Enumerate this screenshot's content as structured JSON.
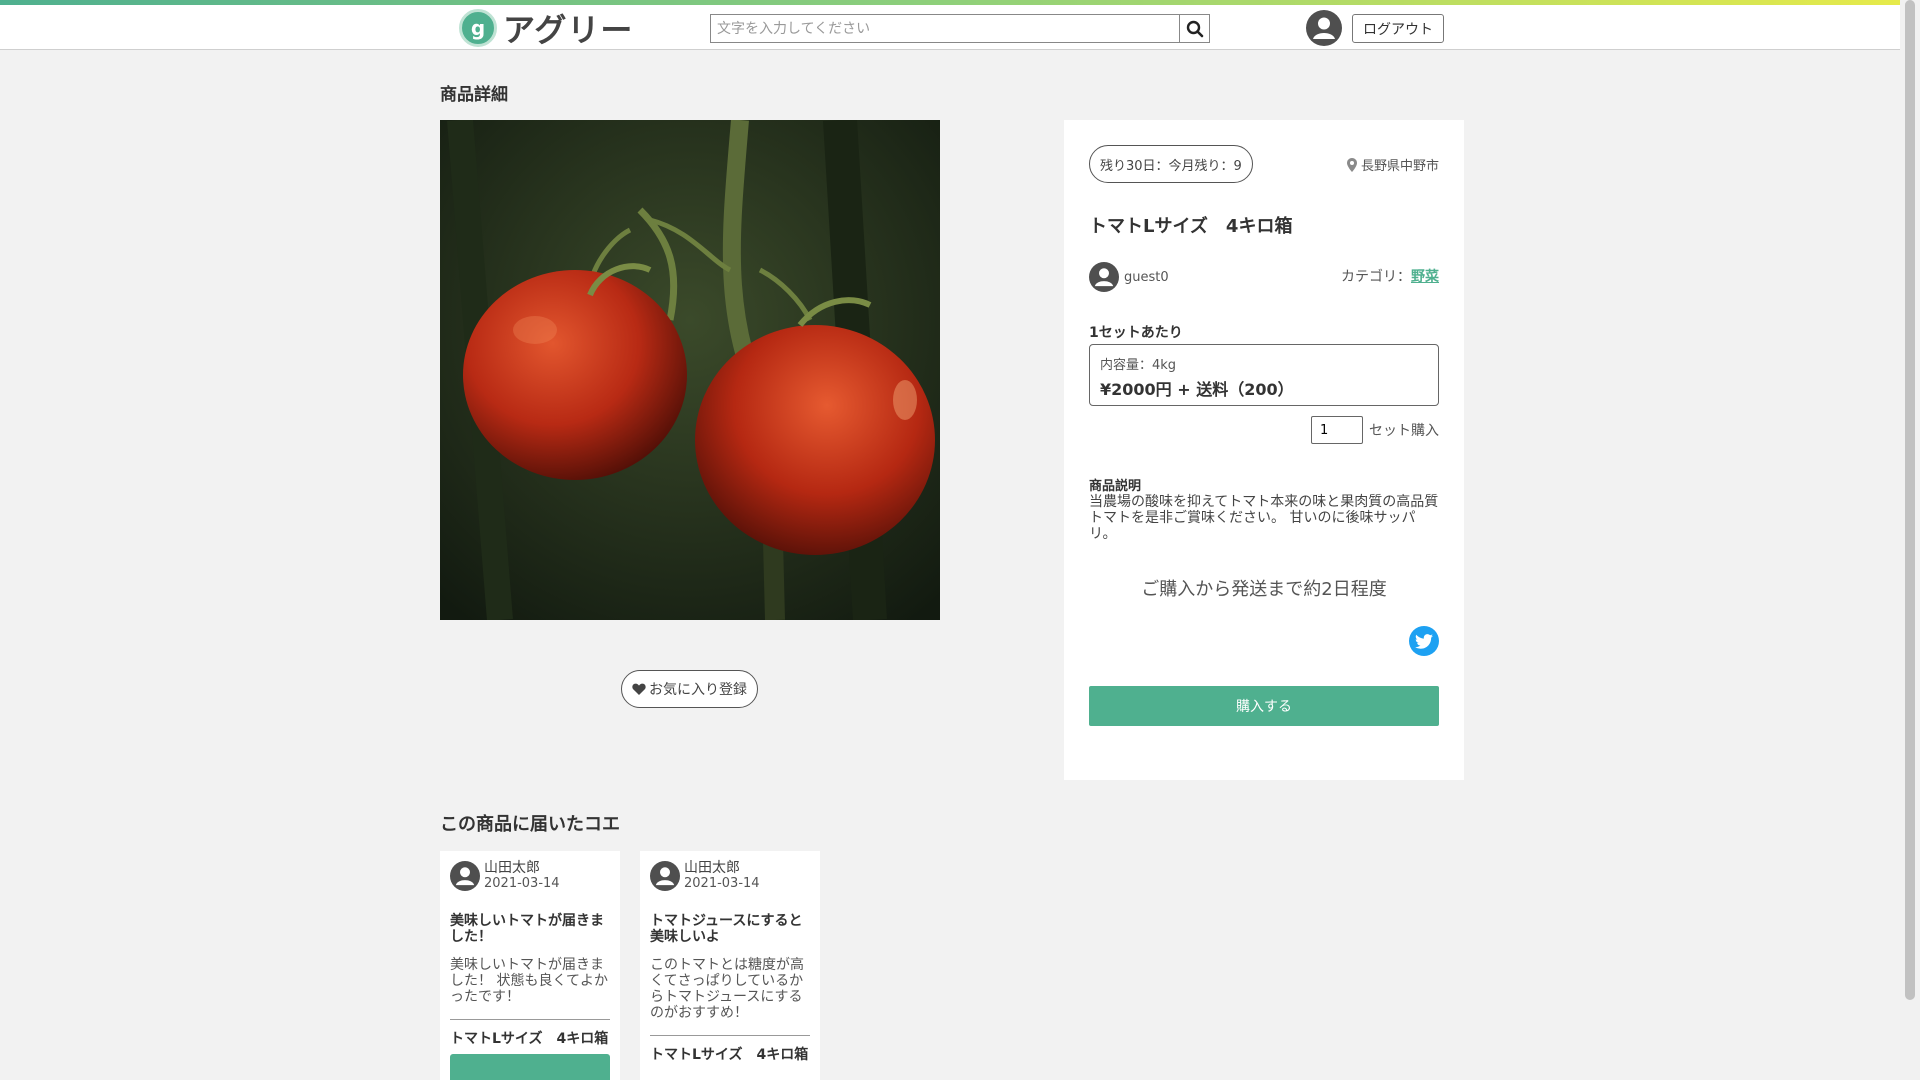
{
  "header": {
    "logo_text": "アグリー",
    "logo_mark": "g",
    "search_placeholder": "文字を入力してください",
    "logout_label": "ログアウト",
    "icons": [
      "search-icon",
      "user-avatar-icon"
    ]
  },
  "page": {
    "title": "商品詳細"
  },
  "favorite": {
    "label": "お気に入り登録",
    "icon": "heart-icon"
  },
  "product": {
    "remaining_badge": "残り30日：今月残り：9",
    "location": "長野県中野市",
    "title": "トマトLサイズ　4キロ箱",
    "seller": "guest0",
    "category_label": "カテゴリ：",
    "category_value": "野菜",
    "per_set_label": "1セットあたり",
    "content_qty": "内容量：4kg",
    "price": "¥2000円 + 送料（200）",
    "quantity": "1",
    "set_purchase_label": "セット購入",
    "description_title": "商品説明",
    "description": "当農場の酸味を抑えてトマト本来の味と果肉質の高品質トマトを是非ご賞味ください。 甘いのに後味サッパリ。",
    "shipping_note": "ご購入から発送まで約2日程度",
    "buy_label": "購入する",
    "share_icon": "twitter-icon"
  },
  "colors": {
    "accent": "#4fb08f",
    "twitter": "#1da1f2",
    "background": "#f2f2f2"
  },
  "voices": {
    "title": "この商品に届いたコエ",
    "items": [
      {
        "name": "山田太郎",
        "date": "2021-03-14",
        "title": "美味しいトマトが届きました！",
        "body": "美味しいトマトが届きました！ 状態も良くてよかったです！",
        "product": "トマトLサイズ　4キロ箱"
      },
      {
        "name": "山田太郎",
        "date": "2021-03-14",
        "title": "トマトジュースにすると美味しいよ",
        "body": "このトマトとは糖度が高くてさっぱりしているからトマトジュースにするのがおすすめ！",
        "product": "トマトLサイズ　4キロ箱"
      }
    ]
  }
}
